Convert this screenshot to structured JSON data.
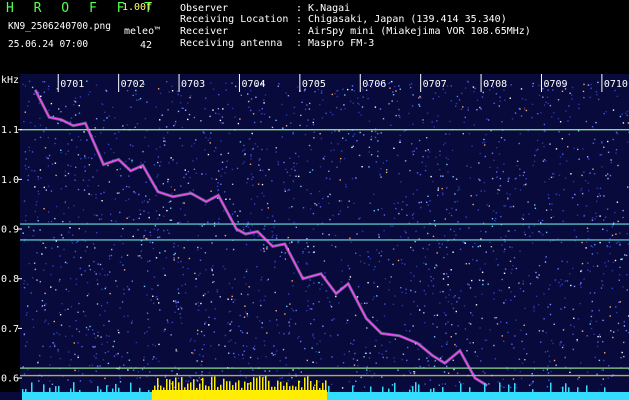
{
  "header": {
    "brand": "H R O F F T",
    "version": "1.00f",
    "filename": "KN9_2506240700.png",
    "datetime": "25.06.24 07:00",
    "meleo_label": "meleo™",
    "meleo_count": "42"
  },
  "info_rows": [
    {
      "label": "Observer",
      "value": ": K.Nagai"
    },
    {
      "label": "Receiving Location",
      "value": ": Chigasaki, Japan (139.414 35.340)"
    },
    {
      "label": "Receiver",
      "value": ": AirSpy mini (Miakejima VOR 108.65MHz)"
    },
    {
      "label": "Receiving antenna",
      "value": ": Maspro FM-3"
    }
  ],
  "spectrogram": {
    "y_unit": "kHz",
    "y_ticks": [
      "1.1",
      "1.0",
      "0.9",
      "0.8",
      "0.7",
      "0.6"
    ],
    "y_tick_values": [
      1.1,
      1.0,
      0.9,
      0.8,
      0.7,
      0.6
    ],
    "y_range": [
      0.58,
      1.2
    ],
    "x_ticks": [
      "0701",
      "0702",
      "0703",
      "0704",
      "0705",
      "0706",
      "0707",
      "0708",
      "0709",
      "0710"
    ],
    "x_tick_values": [
      1,
      2,
      3,
      4,
      5,
      6,
      7,
      8,
      9,
      10
    ],
    "x_range": [
      0.4,
      10.3
    ],
    "horizontal_lines": [
      {
        "freq": 1.1,
        "color": "#9dff9d"
      },
      {
        "freq": 0.91,
        "color": "#66dddd"
      },
      {
        "freq": 0.878,
        "color": "#66dddd"
      },
      {
        "freq": 0.62,
        "color": "#9dff9d"
      },
      {
        "freq": 0.605,
        "color": "#cccc55"
      }
    ],
    "drift_trace": [
      [
        0.62,
        1.18
      ],
      [
        0.85,
        1.125
      ],
      [
        1.05,
        1.12
      ],
      [
        1.25,
        1.108
      ],
      [
        1.45,
        1.113
      ],
      [
        1.75,
        1.03
      ],
      [
        2.0,
        1.04
      ],
      [
        2.2,
        1.017
      ],
      [
        2.4,
        1.028
      ],
      [
        2.65,
        0.975
      ],
      [
        2.9,
        0.965
      ],
      [
        3.2,
        0.972
      ],
      [
        3.45,
        0.955
      ],
      [
        3.65,
        0.968
      ],
      [
        3.95,
        0.9
      ],
      [
        4.1,
        0.89
      ],
      [
        4.3,
        0.895
      ],
      [
        4.55,
        0.865
      ],
      [
        4.75,
        0.87
      ],
      [
        5.05,
        0.8
      ],
      [
        5.35,
        0.81
      ],
      [
        5.6,
        0.77
      ],
      [
        5.8,
        0.79
      ],
      [
        6.1,
        0.72
      ],
      [
        6.35,
        0.69
      ],
      [
        6.65,
        0.685
      ],
      [
        6.95,
        0.67
      ],
      [
        7.2,
        0.645
      ],
      [
        7.4,
        0.63
      ],
      [
        7.65,
        0.655
      ],
      [
        7.9,
        0.6
      ],
      [
        8.1,
        0.585
      ]
    ],
    "colors": {
      "noise_background": "#1a2277",
      "trace": "#ff44ff",
      "bottom_band_left": "#33ddff",
      "bottom_band_middle": "#ffee00",
      "text": "#ffffff"
    }
  }
}
